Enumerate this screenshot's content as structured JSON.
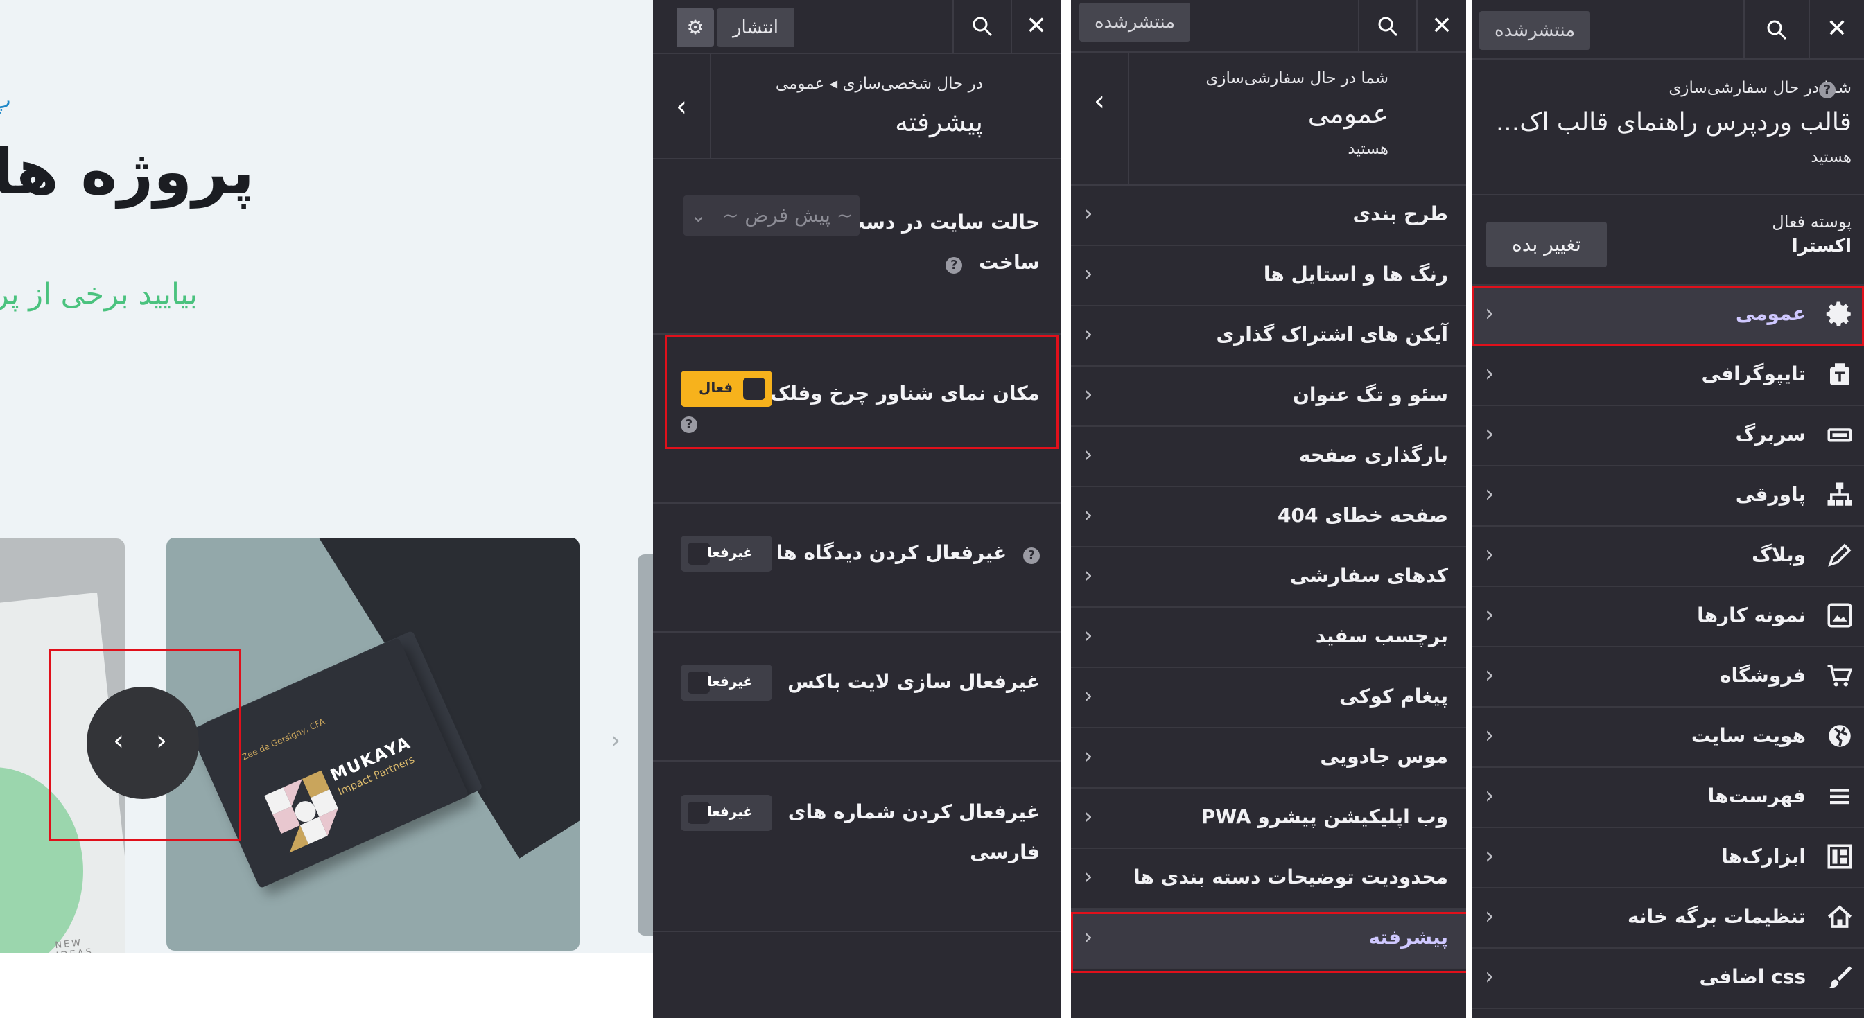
{
  "preview": {
    "pre_mark": "پ",
    "title": "پروژه های",
    "subtitle": "بیایید برخی از پرو",
    "card_name": "Zee de Gersigny, CFA",
    "card_brand": "MUKAYA",
    "card_tag": "Impact Partners",
    "card_ideas": "NEW IDEAS",
    "slider_prev": "‹",
    "slider_next": "›",
    "next_arrow": "›"
  },
  "panel_advanced": {
    "close": "✕",
    "publish_label": "انتشار",
    "breadcrumb": "در حال شخصی‌سازی ◂ عمومی",
    "section_title": "پیشرفته",
    "site_mode_label": "حالت سایت در دست",
    "site_mode_label2": "ساخت",
    "site_mode_value": "~ پیش فرض ~",
    "options": [
      {
        "label": "مکان نمای شناور چرخ وفلک",
        "state": "فعال"
      },
      {
        "label": "غیرفعال کردن دیدگاه ها",
        "state": "غیرفعا"
      },
      {
        "label": "غیرفعال سازی لایت باکس",
        "state": "غیرفعا"
      },
      {
        "label": "غیرفعال کردن شماره های",
        "label2": "فارسی",
        "state": "غیرفعا"
      }
    ]
  },
  "panel_general": {
    "close": "✕",
    "status_label": "منتشرشده",
    "customizing_label": "شما در حال سفارشی‌سازی",
    "section_title": "عمومی",
    "suffix": "هستید",
    "items": [
      "طرح بندی",
      "رنگ ها و استایل ها",
      "آیکن های اشتراک گذاری",
      "سئو و تگ عنوان",
      "بارگذاری صفحه",
      "صفحه خطای 404",
      "کدهای سفارشی",
      "برچسب سفید",
      "پیغام کوکی",
      "موس جادویی",
      "وب اپلیکیشن پیشرو PWA",
      "محدودیت توضیحات دسته بندی ها",
      "پیشرفته"
    ]
  },
  "panel_main": {
    "close": "✕",
    "status_label": "منتشرشده",
    "customizing_label": "شما در حال سفارشی‌سازی",
    "theme_title": "قالب وردپرس راهنمای قالب اک...",
    "suffix": "هستید",
    "active_skin_label": "پوسته فعال",
    "active_skin_value": "اکسترا",
    "change_button": "تغییر بده",
    "items": [
      {
        "label": "عمومی",
        "icon": "gear-icon"
      },
      {
        "label": "تایپوگرافی",
        "icon": "typography-icon"
      },
      {
        "label": "سربرگ",
        "icon": "header-icon"
      },
      {
        "label": "پاورقی",
        "icon": "sitemap-icon"
      },
      {
        "label": "وبلاگ",
        "icon": "pencil-icon"
      },
      {
        "label": "نمونه کارها",
        "icon": "image-icon"
      },
      {
        "label": "فروشگاه",
        "icon": "cart-icon"
      },
      {
        "label": "هویت سایت",
        "icon": "globe-icon"
      },
      {
        "label": "فهرست‌ها",
        "icon": "menu-icon"
      },
      {
        "label": "ابزارک‌ها",
        "icon": "widgets-icon"
      },
      {
        "label": "تنظیمات برگه خانه",
        "icon": "home-icon"
      },
      {
        "label": "css اضافی",
        "icon": "brush-icon"
      }
    ]
  },
  "colors": {
    "panel_bg": "#2b2a32",
    "toggle_on": "#f7b21c",
    "highlight": "#e0101b",
    "accent_text": "#cfc8ff"
  }
}
